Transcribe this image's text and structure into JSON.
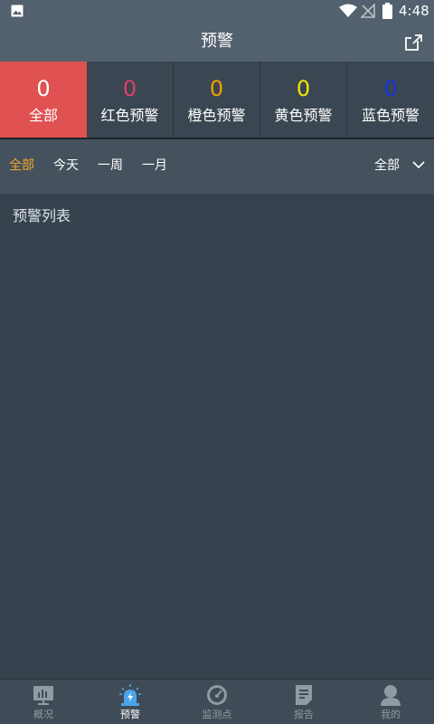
{
  "status_bar": {
    "time": "4:48",
    "icons": [
      "gallery-icon",
      "wifi-icon",
      "no-signal-icon",
      "battery-icon"
    ]
  },
  "header": {
    "title": "预警",
    "action_icon": "share-icon"
  },
  "levels": [
    {
      "count": "0",
      "label": "全部",
      "color": "#ffffff",
      "active": true
    },
    {
      "count": "0",
      "label": "红色预警",
      "color": "#e0406a",
      "active": false
    },
    {
      "count": "0",
      "label": "橙色预警",
      "color": "#f0a000",
      "active": false
    },
    {
      "count": "0",
      "label": "黄色预警",
      "color": "#f5e600",
      "active": false
    },
    {
      "count": "0",
      "label": "蓝色预警",
      "color": "#1a33d6",
      "active": false
    }
  ],
  "filters": {
    "tabs": [
      "全部",
      "今天",
      "一周",
      "一月"
    ],
    "active_tab": "全部",
    "dropdown_value": "全部",
    "active_color": "#f5a623"
  },
  "content": {
    "section_title": "预警列表"
  },
  "bottom_nav": [
    {
      "label": "概况",
      "icon": "overview-chart-icon",
      "active": false
    },
    {
      "label": "预警",
      "icon": "alarm-light-icon",
      "active": true
    },
    {
      "label": "监测点",
      "icon": "gauge-icon",
      "active": false
    },
    {
      "label": "报告",
      "icon": "report-icon",
      "active": false
    },
    {
      "label": "我的",
      "icon": "user-icon",
      "active": false
    }
  ],
  "colors": {
    "accent_active_level": "#e05151",
    "nav_active_icon": "#4aa3e8"
  }
}
